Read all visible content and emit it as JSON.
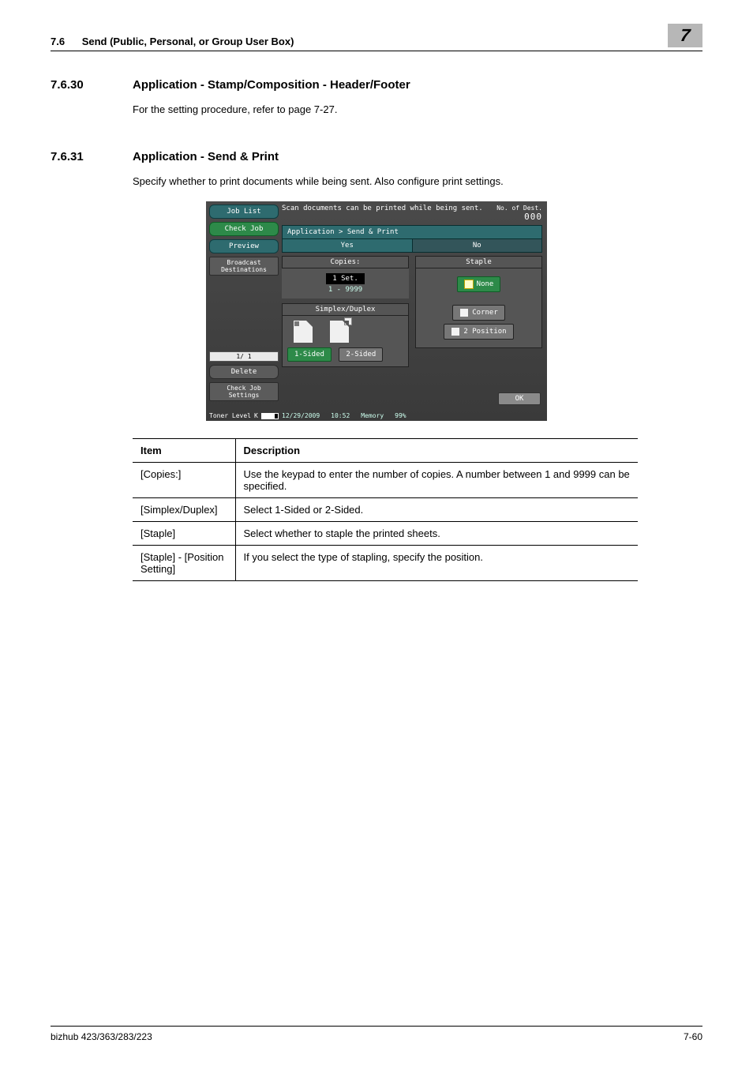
{
  "header": {
    "section_number": "7.6",
    "section_title": "Send (Public, Personal, or Group User Box)",
    "chapter": "7"
  },
  "sections": [
    {
      "num": "7.6.30",
      "title": "Application - Stamp/Composition - Header/Footer",
      "text": "For the setting procedure, refer to page 7-27."
    },
    {
      "num": "7.6.31",
      "title": "Application - Send & Print",
      "text": "Specify whether to print documents while being sent. Also configure print settings."
    }
  ],
  "screenshot": {
    "help": "Scan documents can be printed while being sent.",
    "dest_label": "No. of Dest.",
    "dest_value": "000",
    "side": {
      "job_list": "Job List",
      "check_job": "Check Job",
      "preview": "Preview",
      "broadcast": "Broadcast Destinations",
      "pager": "1/ 1",
      "delete": "Delete",
      "check_set": "Check Job Settings"
    },
    "crumb": "Application > Send & Print",
    "yes": "Yes",
    "no": "No",
    "copies_label": "Copies:",
    "copies_value": "1 Set.",
    "copies_range": "1   -   9999",
    "staple_label": "Staple",
    "staple_none": "None",
    "staple_corner": "Corner",
    "staple_two": "2 Position",
    "sd_label": "Simplex/Duplex",
    "sd_one": "1-Sided",
    "sd_two": "2-Sided",
    "ok": "OK",
    "date": "12/29/2009",
    "time": "10:52",
    "mem_label": "Memory",
    "mem_value": "99%",
    "toner": "Toner Level",
    "toner_k": "K"
  },
  "table": {
    "headers": {
      "c1": "Item",
      "c2": "Description"
    },
    "rows": [
      {
        "item": "[Copies:]",
        "desc": "Use the keypad to enter the number of copies. A number between 1 and 9999 can be specified."
      },
      {
        "item": "[Simplex/Duplex]",
        "desc": "Select 1-Sided or 2-Sided."
      },
      {
        "item": "[Staple]",
        "desc": "Select whether to staple the printed sheets."
      },
      {
        "item": "[Staple] - [Position Setting]",
        "desc": "If you select the type of stapling, specify the position."
      }
    ]
  },
  "footer": {
    "left": "bizhub 423/363/283/223",
    "right": "7-60"
  }
}
